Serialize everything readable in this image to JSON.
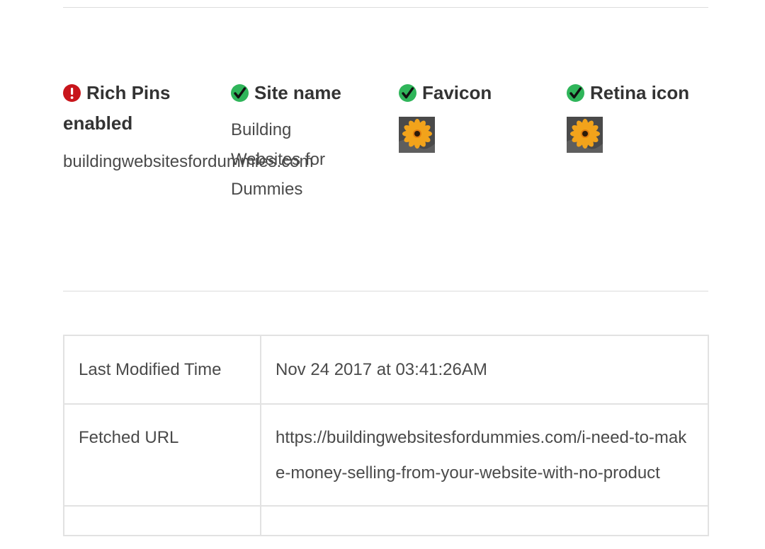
{
  "status_items": [
    {
      "icon": "error-icon",
      "label": "Rich Pins enabled",
      "value": "buildingwebsitesfordummies.com"
    },
    {
      "icon": "check-icon",
      "label": "Site name",
      "value": "Building Websites for Dummies"
    },
    {
      "icon": "check-icon",
      "label": "Favicon",
      "image": "flower-favicon"
    },
    {
      "icon": "check-icon",
      "label": "Retina icon",
      "image": "flower-retina-icon"
    }
  ],
  "colors": {
    "error": "#c8151b",
    "success": "#2fb55a",
    "border": "#e2e2e2"
  },
  "table": {
    "rows": [
      {
        "key": "Last Modified Time",
        "value": "Nov 24 2017 at 03:41:26AM"
      },
      {
        "key": "Fetched URL",
        "value": "https://buildingwebsitesfordummies.com/i-need-to-make-money-selling-from-your-website-with-no-product"
      }
    ]
  }
}
